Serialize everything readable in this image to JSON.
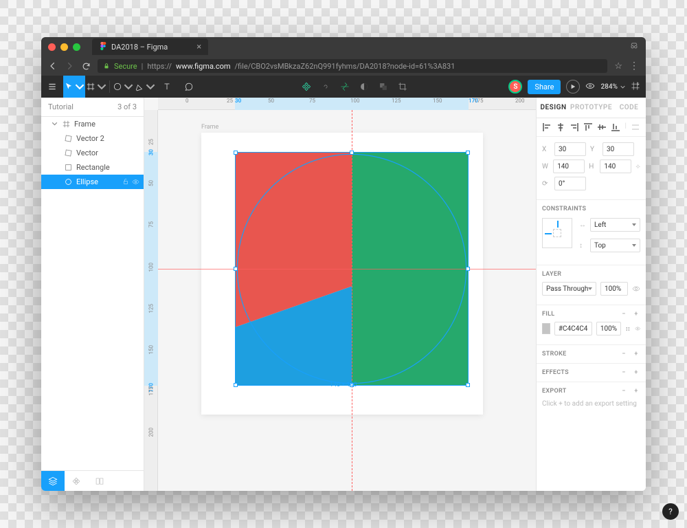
{
  "browser": {
    "tab_title": "DA2018 – Figma",
    "secure_label": "Secure",
    "url_prefix": "https://",
    "url_host": "www.figma.com",
    "url_path": "/file/CBO2vsMBkzaZ62nQ991fyhms/DA2018?node-id=61%3A831"
  },
  "toolbar": {
    "share_label": "Share",
    "zoom": "284%",
    "avatar_initial": "S"
  },
  "left_panel": {
    "title": "Tutorial",
    "page_count": "3 of 3",
    "layers": {
      "frame": "Frame",
      "vector2": "Vector 2",
      "vector": "Vector",
      "rectangle": "Rectangle",
      "ellipse": "Ellipse"
    }
  },
  "canvas": {
    "frame_label": "Frame",
    "selection_size": "140 × 140",
    "ruler_h": [
      "0",
      "25",
      "50",
      "75",
      "100",
      "125",
      "150",
      "175",
      "200"
    ],
    "ruler_h_hl": [
      "30",
      "170"
    ],
    "ruler_v": [
      "25",
      "50",
      "75",
      "100",
      "125",
      "150",
      "175",
      "200"
    ],
    "ruler_v_hl": [
      "30",
      "170"
    ]
  },
  "right_panel": {
    "tabs": {
      "design": "DESIGN",
      "prototype": "PROTOTYPE",
      "code": "CODE"
    },
    "position": {
      "x": "30",
      "y": "30",
      "w": "140",
      "h": "140",
      "rotation": "0°"
    },
    "constraints": {
      "title": "CONSTRAINTS",
      "horiz": "Left",
      "vert": "Top"
    },
    "layer": {
      "title": "LAYER",
      "blend": "Pass Through",
      "opacity": "100%"
    },
    "fill": {
      "title": "FILL",
      "hex": "#C4C4C4",
      "opacity": "100%"
    },
    "stroke": {
      "title": "STROKE"
    },
    "effects": {
      "title": "EFFECTS"
    },
    "export": {
      "title": "EXPORT",
      "hint": "Click + to add an export setting"
    }
  },
  "colors": {
    "accent": "#18a0fb",
    "red": "#e74c3c",
    "green": "#26a96c",
    "blue": "#18a0fb",
    "swatch": "#c4c4c4"
  }
}
